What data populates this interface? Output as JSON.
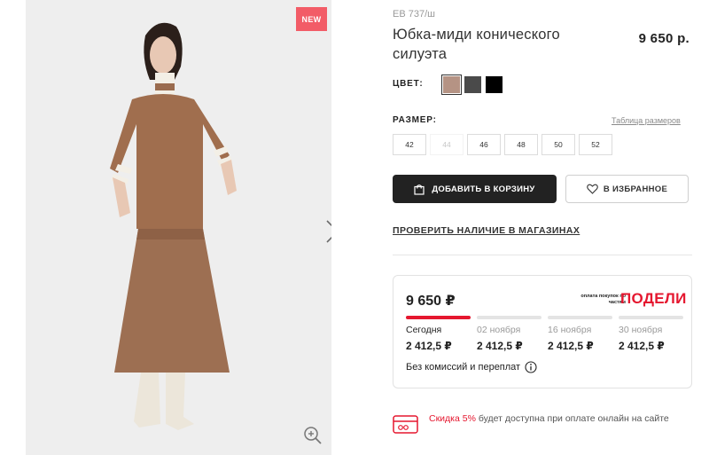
{
  "gallery": {
    "badge": "NEW",
    "next_icon": "chevron-right-icon",
    "zoom_icon": "zoom-in-icon"
  },
  "product": {
    "sku": "EB 737/ш",
    "title": "Юбка-миди конического силуэта",
    "price": "9 650 р."
  },
  "colors": {
    "label": "ЦВЕТ:",
    "options": [
      {
        "hex": "#b59384",
        "selected": true
      },
      {
        "hex": "#4a4a4a",
        "selected": false
      },
      {
        "hex": "#000000",
        "selected": false
      }
    ]
  },
  "sizes": {
    "label": "РАЗМЕР:",
    "table_link": "Таблица размеров",
    "options": [
      {
        "label": "42",
        "available": true
      },
      {
        "label": "44",
        "available": false
      },
      {
        "label": "46",
        "available": true
      },
      {
        "label": "48",
        "available": true
      },
      {
        "label": "50",
        "available": true
      },
      {
        "label": "52",
        "available": true
      }
    ]
  },
  "actions": {
    "add_to_cart": "ДОБАВИТЬ В КОРЗИНУ",
    "add_to_cart_icon": "shopping-bag-icon",
    "favorite": "В ИЗБРАННОЕ",
    "favorite_icon": "heart-icon",
    "check_stores": "ПРОВЕРИТЬ НАЛИЧИЕ В МАГАЗИНАХ"
  },
  "installments": {
    "total": "9 650 ₽",
    "provider_note": "оплата покупок по частям",
    "provider": "ПОДЕЛИ",
    "steps": [
      {
        "date": "Сегодня",
        "amount": "2 412,5 ₽",
        "active": true
      },
      {
        "date": "02 ноября",
        "amount": "2 412,5 ₽",
        "active": false
      },
      {
        "date": "16 ноября",
        "amount": "2 412,5 ₽",
        "active": false
      },
      {
        "date": "30 ноября",
        "amount": "2 412,5 ₽",
        "active": false
      }
    ],
    "footer": "Без комиссий и переплат",
    "footer_icon": "info-icon"
  },
  "discount": {
    "icon": "card-discount-icon",
    "highlight": "Скидка 5%",
    "text": " будет доступна при оплате онлайн на сайте"
  },
  "colors_theme": {
    "accent_red": "#e5172f",
    "badge_pink": "#f25c67",
    "primary_dark": "#222222"
  }
}
